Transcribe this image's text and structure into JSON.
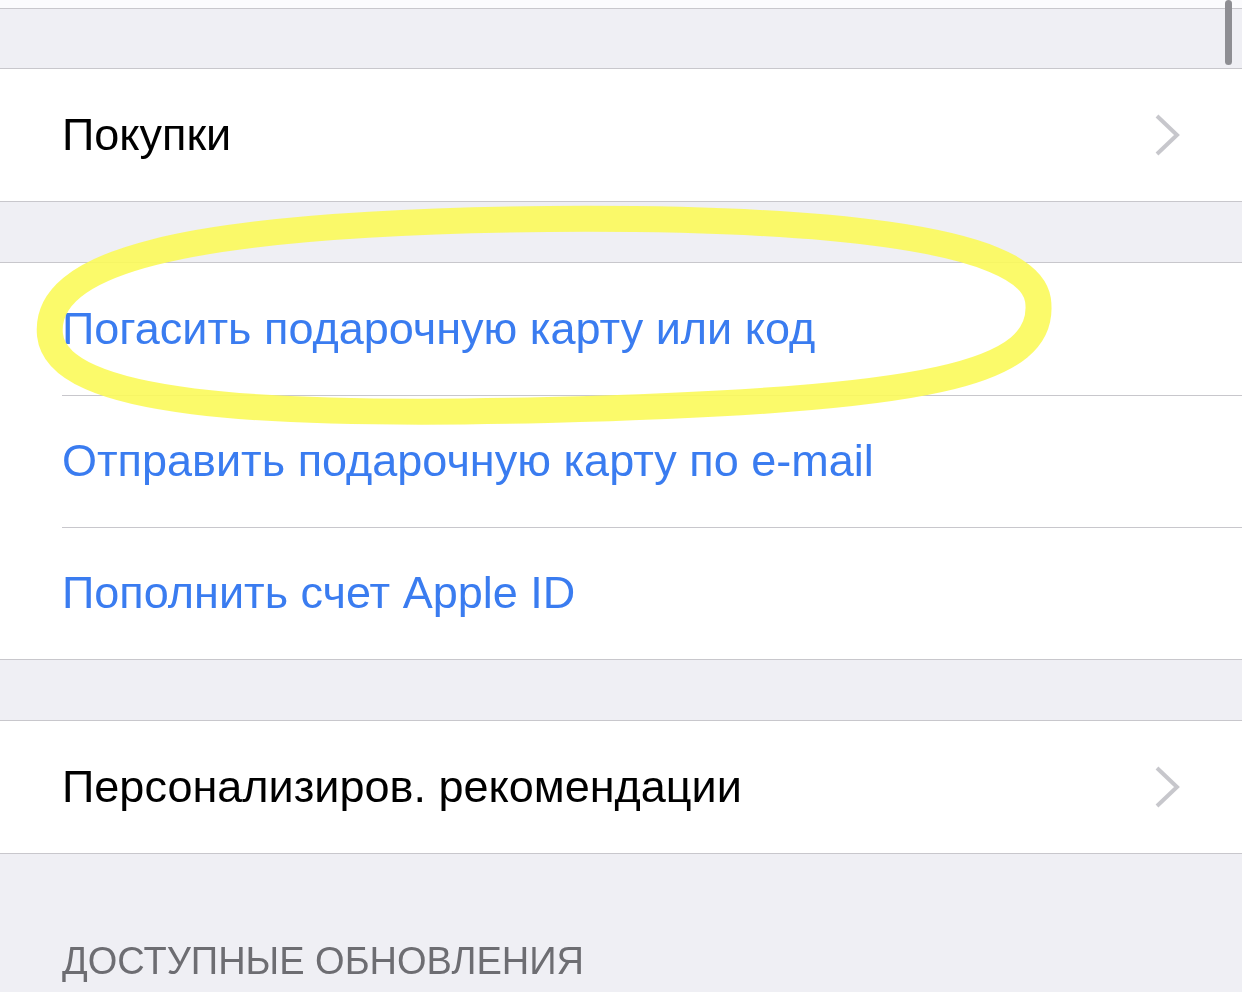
{
  "groups": [
    {
      "rows": [
        {
          "label": "Покупки",
          "kind": "nav"
        }
      ]
    },
    {
      "rows": [
        {
          "label": "Погасить подарочную карту или код",
          "kind": "action",
          "highlighted": true
        },
        {
          "label": "Отправить подарочную карту по e-mail",
          "kind": "action",
          "highlighted": false
        },
        {
          "label": "Пополнить счет Apple ID",
          "kind": "action",
          "highlighted": false
        }
      ]
    },
    {
      "rows": [
        {
          "label": "Персонализиров. рекомендации",
          "kind": "nav"
        }
      ]
    }
  ],
  "section_header": "ДОСТУПНЫЕ ОБНОВЛЕНИЯ"
}
